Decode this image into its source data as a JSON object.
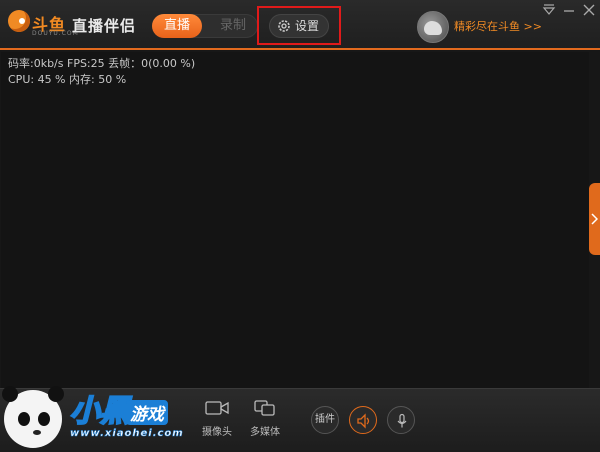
{
  "app": {
    "logo_text": "斗鱼",
    "logo_sub": "DOUYU.COM",
    "name": "直播伴侣"
  },
  "mode_toggle": {
    "live_label": "直播",
    "record_label": "录制",
    "selected": "直播"
  },
  "settings": {
    "label": "设置"
  },
  "user": {
    "promo_text": "精彩尽在斗鱼 >>"
  },
  "window_controls": [
    "menu-dropdown",
    "minimize",
    "close"
  ],
  "stats": {
    "line1": "码率:0kb/s   FPS:25  丢帧：0(0.00 %)",
    "line2": "CPU: 45 %    内存: 50 %"
  },
  "sources": [
    {
      "icon": "camera-icon",
      "label": "摄像头"
    },
    {
      "icon": "multimedia-icon",
      "label": "多媒体"
    }
  ],
  "tools": {
    "plugin_label": "插件",
    "speaker_icon": "speaker-icon",
    "mic_icon": "microphone-icon"
  },
  "watermark": {
    "big_text": "小黑",
    "tag_text": "游戏",
    "url": "www.xiaohei.com"
  },
  "colors": {
    "accent": "#e8621a",
    "highlight_box": "#e01a1a",
    "background": "#171717"
  }
}
